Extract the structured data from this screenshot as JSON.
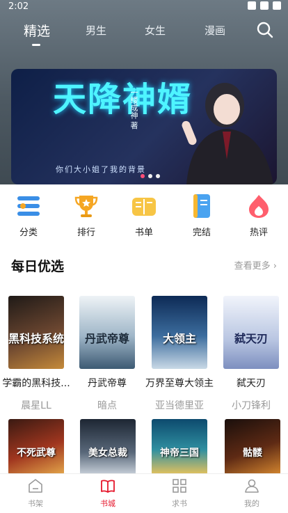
{
  "status_bar": {
    "time": "2:02"
  },
  "top_tabs": [
    {
      "label": "精选",
      "active": true
    },
    {
      "label": "男生",
      "active": false
    },
    {
      "label": "女生",
      "active": false
    },
    {
      "label": "漫画",
      "active": false
    }
  ],
  "banner": {
    "title": "天降神婿",
    "author": "一缕成神 著",
    "subtitle": "你们大小姐了我的背景",
    "slides": 3,
    "active_slide": 1
  },
  "categories": [
    {
      "label": "分类",
      "icon": "category-icon",
      "color": "#3a8ee6"
    },
    {
      "label": "排行",
      "icon": "trophy-icon",
      "color": "#f5a623"
    },
    {
      "label": "书单",
      "icon": "booklist-icon",
      "color": "#f7b731"
    },
    {
      "label": "完结",
      "icon": "finished-book-icon",
      "color": "#4aa3f0"
    },
    {
      "label": "热评",
      "icon": "flame-icon",
      "color": "#ff5f6d"
    }
  ],
  "daily_picks": {
    "title": "每日优选",
    "more_label": "查看更多",
    "books": [
      {
        "name": "学霸的黑科技...",
        "author": "晨星LL",
        "cover_text": "黑科技系统"
      },
      {
        "name": "丹武帝尊",
        "author": "暗点",
        "cover_text": "丹武帝尊"
      },
      {
        "name": "万界至尊大领主",
        "author": "亚当德里亚",
        "cover_text": "大领主"
      },
      {
        "name": "弑天刃",
        "author": "小刀锋利",
        "cover_text": "弑天刃"
      }
    ],
    "second_row_covers": [
      "不死武尊",
      "美女总裁",
      "神帝三国",
      "骷髅"
    ]
  },
  "bottom_nav": [
    {
      "label": "书架",
      "icon": "bookshelf-icon",
      "active": false
    },
    {
      "label": "书城",
      "icon": "bookstore-icon",
      "active": true
    },
    {
      "label": "求书",
      "icon": "grid-icon",
      "active": false
    },
    {
      "label": "我的",
      "icon": "profile-icon",
      "active": false
    }
  ],
  "colors": {
    "accent": "#e5162b",
    "header": "#56636c"
  }
}
